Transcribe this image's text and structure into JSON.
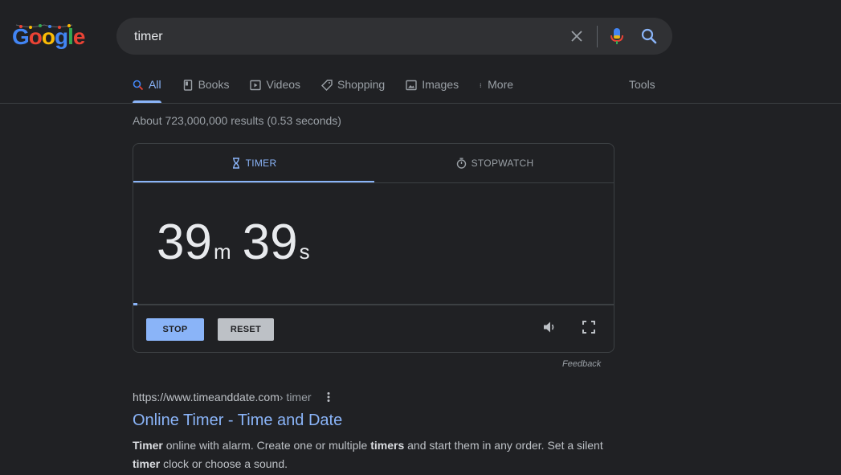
{
  "logo": {
    "letters": [
      "G",
      "o",
      "o",
      "g",
      "l",
      "e"
    ]
  },
  "search": {
    "query": "timer",
    "placeholder": ""
  },
  "icons": {
    "clear": "close-icon",
    "mic": "mic-icon",
    "search": "search-icon",
    "more": "vertical-dots-icon",
    "hourglass": "hourglass-icon",
    "stopwatch": "stopwatch-icon",
    "volume": "volume-icon",
    "fullscreen": "fullscreen-icon"
  },
  "tabs": [
    {
      "label": "All",
      "icon": "search-icon",
      "active": true
    },
    {
      "label": "Books",
      "icon": "book-icon",
      "active": false
    },
    {
      "label": "Videos",
      "icon": "video-icon",
      "active": false
    },
    {
      "label": "Shopping",
      "icon": "tag-icon",
      "active": false
    },
    {
      "label": "Images",
      "icon": "image-icon",
      "active": false
    },
    {
      "label": "More",
      "icon": "vertical-dots-icon",
      "active": false
    }
  ],
  "tools_label": "Tools",
  "stats": "About 723,000,000 results (0.53 seconds)",
  "timer_widget": {
    "tab_timer": "TIMER",
    "tab_stopwatch": "STOPWATCH",
    "minutes": "39",
    "minutes_unit": "m",
    "seconds": "39",
    "seconds_unit": "s",
    "progress_fraction": 0.008,
    "stop_label": "STOP",
    "reset_label": "RESET",
    "feedback_label": "Feedback"
  },
  "result": {
    "url": "https://www.timeanddate.com",
    "breadcrumb": " › timer",
    "title": "Online Timer - Time and Date",
    "snippet": [
      {
        "text": "Timer",
        "bold": true
      },
      {
        "text": " online with alarm. Create one or multiple ",
        "bold": false
      },
      {
        "text": "timers",
        "bold": true
      },
      {
        "text": " and start them in any order. Set a silent ",
        "bold": false
      },
      {
        "text": "timer",
        "bold": true
      },
      {
        "text": " clock or choose a sound.",
        "bold": false
      }
    ]
  },
  "colors": {
    "background": "#202124",
    "accent": "#8ab4f8",
    "text_primary": "#e8eaed",
    "text_secondary": "#9aa0a6"
  }
}
